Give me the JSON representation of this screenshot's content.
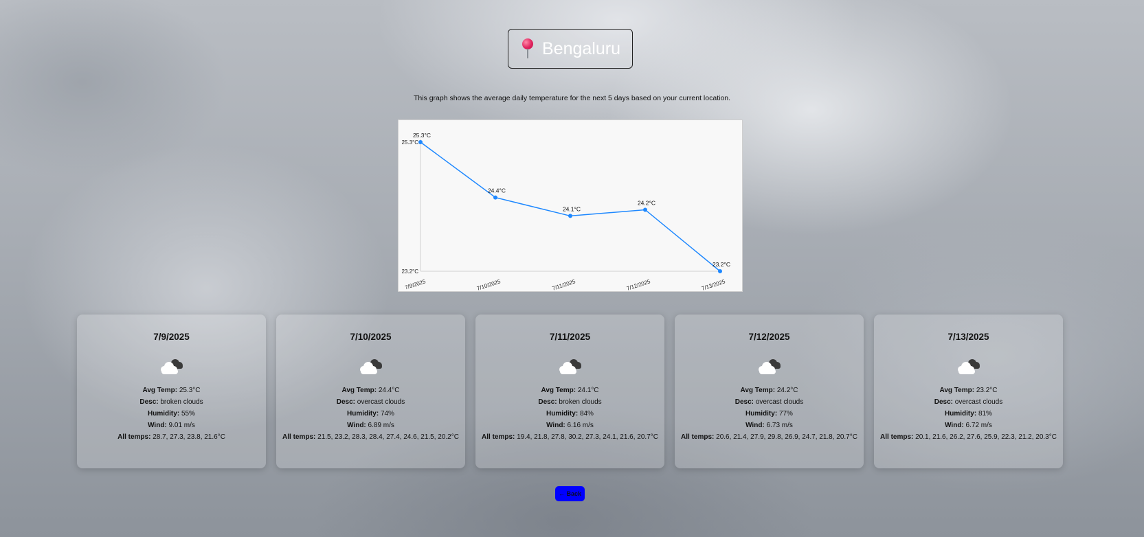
{
  "location": {
    "city": "Bengaluru",
    "icon": "pin-icon"
  },
  "subtitle": "This graph shows the average daily temperature for the next 5 days based on your current location.",
  "chart_data": {
    "type": "line",
    "x": [
      "7/9/2025",
      "7/10/2025",
      "7/11/2025",
      "7/12/2025",
      "7/13/2025"
    ],
    "series": [
      {
        "values": [
          25.3,
          24.4,
          24.1,
          24.2,
          23.2
        ],
        "color": "#1e88ff"
      }
    ],
    "point_labels": [
      "25.3°C",
      "24.4°C",
      "24.1°C",
      "24.2°C",
      "23.2°C"
    ],
    "y_ticks": [
      "25.3°C",
      "23.2°C"
    ],
    "ylim": [
      23.2,
      25.3
    ],
    "grid": false
  },
  "labels": {
    "avg_temp": "Avg Temp:",
    "desc": "Desc:",
    "humidity": "Humidity:",
    "wind": "Wind:",
    "all_temps": "All temps:"
  },
  "days": [
    {
      "date": "7/9/2025",
      "icon": "broken-clouds-icon",
      "avg_temp": "25.3°C",
      "desc": "broken clouds",
      "humidity": "55%",
      "wind": "9.01 m/s",
      "all_temps": "28.7, 27.3, 23.8, 21.6°C"
    },
    {
      "date": "7/10/2025",
      "icon": "overcast-clouds-icon",
      "avg_temp": "24.4°C",
      "desc": "overcast clouds",
      "humidity": "74%",
      "wind": "6.89 m/s",
      "all_temps": "21.5, 23.2, 28.3, 28.4, 27.4, 24.6, 21.5, 20.2°C"
    },
    {
      "date": "7/11/2025",
      "icon": "broken-clouds-icon",
      "avg_temp": "24.1°C",
      "desc": "broken clouds",
      "humidity": "84%",
      "wind": "6.16 m/s",
      "all_temps": "19.4, 21.8, 27.8, 30.2, 27.3, 24.1, 21.6, 20.7°C"
    },
    {
      "date": "7/12/2025",
      "icon": "overcast-clouds-icon",
      "avg_temp": "24.2°C",
      "desc": "overcast clouds",
      "humidity": "77%",
      "wind": "6.73 m/s",
      "all_temps": "20.6, 21.4, 27.9, 29.8, 26.9, 24.7, 21.8, 20.7°C"
    },
    {
      "date": "7/13/2025",
      "icon": "overcast-clouds-icon",
      "avg_temp": "23.2°C",
      "desc": "overcast clouds",
      "humidity": "81%",
      "wind": "6.72 m/s",
      "all_temps": "20.1, 21.6, 26.2, 27.6, 25.9, 22.3, 21.2, 20.3°C"
    }
  ],
  "back_button": {
    "label": "← Back"
  }
}
